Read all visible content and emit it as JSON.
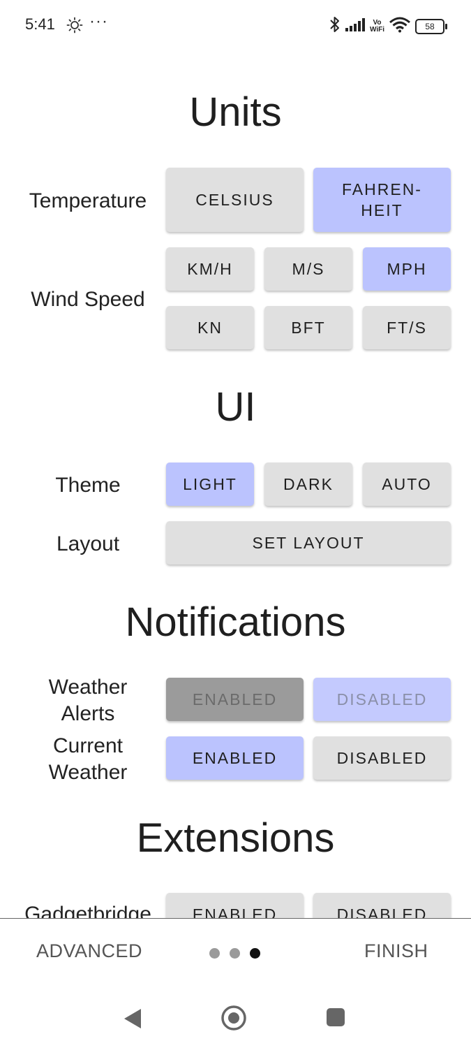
{
  "status": {
    "time": "5:41",
    "dots": "···",
    "vowifi_top": "Vo",
    "vowifi_bottom": "WiFi",
    "battery": "58"
  },
  "sections": {
    "units": "Units",
    "ui": "UI",
    "notifications": "Notifications",
    "extensions": "Extensions"
  },
  "units": {
    "temperature_label": "Temperature",
    "celsius": "CELSIUS",
    "fahrenheit_line1": "FAHREN-",
    "fahrenheit_line2": "HEIT",
    "wind_label": "Wind Speed",
    "kmh": "KM/H",
    "ms": "M/S",
    "mph": "MPH",
    "kn": "KN",
    "bft": "BFT",
    "fts": "FT/S",
    "selected_temperature": "FAHRENHEIT",
    "selected_wind": "MPH"
  },
  "ui": {
    "theme_label": "Theme",
    "light": "LIGHT",
    "dark": "DARK",
    "auto": "AUTO",
    "selected_theme": "LIGHT",
    "layout_label": "Layout",
    "set_layout": "SET LAYOUT"
  },
  "notifications": {
    "alerts_label_line1": "Weather",
    "alerts_label_line2": "Alerts",
    "alerts_enabled": "ENABLED",
    "alerts_disabled": "DISABLED",
    "current_label_line1": "Current",
    "current_label_line2": "Weather",
    "current_enabled": "ENABLED",
    "current_disabled": "DISABLED",
    "selected_current": "ENABLED"
  },
  "extensions": {
    "gadgetbridge_label": "Gadgetbridge",
    "enabled": "ENABLED",
    "disabled": "DISABLED"
  },
  "footer": {
    "advanced": "ADVANCED",
    "finish": "FINISH",
    "page_count": 3,
    "current_page": 3
  },
  "colors": {
    "selected": "#bbc3fe",
    "unselected": "#e0e0e0",
    "disabled": "#9b9b9b"
  }
}
